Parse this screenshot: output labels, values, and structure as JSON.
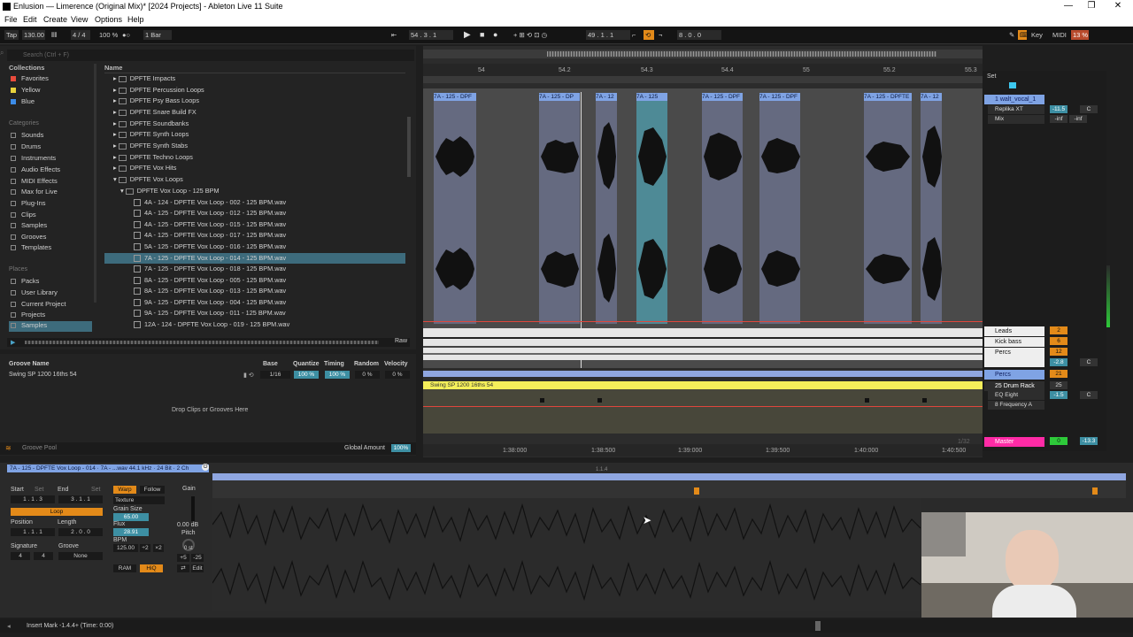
{
  "window": {
    "title": "Enlusion — Limerence (Original Mix)* [2024 Projects] - Ableton Live 11 Suite",
    "minimize": "—",
    "maximize": "❐",
    "close": "✕"
  },
  "menu": [
    "File",
    "Edit",
    "Create",
    "View",
    "Options",
    "Help"
  ],
  "transport": {
    "tap": "Tap",
    "tempo": "130.00",
    "signature": "4 / 4",
    "zoom": "100 %",
    "quantization": "1 Bar",
    "position": "54 . 3 . 1",
    "loop_start": "49 . 1 . 1",
    "loop_length": "8 . 0 . 0",
    "key": "Key",
    "midi": "MIDI",
    "cpu": "13 %"
  },
  "browser": {
    "search_placeholder": "Search (Ctrl + F)",
    "collections_header": "Collections",
    "name_header": "Name",
    "collections": [
      {
        "label": "Favorites",
        "color": "#e84b3c"
      },
      {
        "label": "Yellow",
        "color": "#e8d23c"
      },
      {
        "label": "Blue",
        "color": "#3c8ce8"
      }
    ],
    "categories_header": "Categories",
    "categories": [
      "Sounds",
      "Drums",
      "Instruments",
      "Audio Effects",
      "MIDI Effects",
      "Max for Live",
      "Plug-Ins",
      "Clips",
      "Samples",
      "Grooves",
      "Templates"
    ],
    "places_header": "Places",
    "places": [
      "Packs",
      "User Library",
      "Current Project",
      "Projects",
      "Samples"
    ],
    "folders": [
      "DPFTE Impacts",
      "DPFTE Percussion Loops",
      "DPFTE Psy Bass Loops",
      "DPFTE Snare Build FX",
      "DPFTE Soundbanks",
      "DPFTE Synth Loops",
      "DPFTE Synth Stabs",
      "DPFTE Techno Loops",
      "DPFTE Vox Hits",
      "DPFTE Vox Loops"
    ],
    "subfolder": "DPFTE Vox Loop - 125 BPM",
    "files": [
      "4A - 124 - DPFTE Vox Loop - 002 - 125 BPM.wav",
      "4A - 125 - DPFTE Vox Loop - 012 - 125 BPM.wav",
      "4A - 125 - DPFTE Vox Loop - 015 - 125 BPM.wav",
      "4A - 125 - DPFTE Vox Loop - 017 - 125 BPM.wav",
      "5A - 125 - DPFTE Vox Loop - 016 - 125 BPM.wav",
      "7A - 125 - DPFTE Vox Loop - 014 - 125 BPM.wav",
      "7A - 125 - DPFTE Vox Loop - 018 - 125 BPM.wav",
      "8A - 125 - DPFTE Vox Loop - 005 - 125 BPM.wav",
      "8A - 125 - DPFTE Vox Loop - 013 - 125 BPM.wav",
      "9A - 125 - DPFTE Vox Loop - 004 - 125 BPM.wav",
      "9A - 125 - DPFTE Vox Loop - 011 - 125 BPM.wav",
      "12A - 124 - DPFTE Vox Loop - 019 - 125 BPM.wav"
    ],
    "raw": "Raw"
  },
  "groove": {
    "headers": {
      "name": "Groove Name",
      "base": "Base",
      "quantize": "Quantize",
      "timing": "Timing",
      "random": "Random",
      "velocity": "Velocity"
    },
    "row": {
      "name": "Swing SP 1200 16ths 54",
      "base": "1/16",
      "quantize": "100 %",
      "timing": "100 %",
      "random": "0 %",
      "velocity": "0 %"
    },
    "drop_hint": "Drop Clips or Grooves Here",
    "pool_label": "Groove Pool",
    "global_amount_label": "Global Amount",
    "global_amount": "100%"
  },
  "arrangement": {
    "bars": [
      "54",
      "54.2",
      "54.3",
      "54.4",
      "55",
      "55.2",
      "55.3"
    ],
    "times": [
      "1:38:000",
      "1:38:500",
      "1:39:000",
      "1:39:500",
      "1:40:000",
      "1:40:500"
    ],
    "set_label": "Set",
    "clip_labels": [
      "7A - 125 - DPF",
      "7A - 125 - DP",
      "7A - 12",
      "7A - 125",
      "7A - 125 - DPF",
      "7A - 125 - DPF",
      "7A - 125 - DPFTE",
      "7A - 12"
    ],
    "groove_clip": "Swing SP 1200 16ths 54",
    "zoom_label": "1/32"
  },
  "mixer": {
    "tracks": [
      {
        "name": "1 walt_vocal_1",
        "color": "#7fa3e4",
        "devices": [
          "Replika XT",
          "Mix"
        ],
        "vol": "-11.5",
        "pan": "C",
        "send": "-inf"
      },
      {
        "name": "Leads",
        "color": "#f0f0f0",
        "num": "2"
      },
      {
        "name": "Kick bass",
        "color": "#f0f0f0",
        "num": "6"
      },
      {
        "name": "Percs",
        "color": "#f0f0f0",
        "num": "12",
        "vol": "-2.8",
        "pan": "C"
      },
      {
        "name": "Percs",
        "color": "#7fa3e4",
        "num": "21"
      },
      {
        "name": "25 Drum Rack",
        "color": "#f0f0f0",
        "num": "25",
        "devices": [
          "EQ Eight",
          "8 Frequency A"
        ],
        "vol": "-1.5",
        "pan": "C"
      },
      {
        "name": "Master",
        "color": "#ff2ba6",
        "num": "0",
        "vol": "-13.3"
      }
    ]
  },
  "detail": {
    "clip_name": "7A - 125 - DPFTE Vox Loop - 014",
    "clip_info": "7A - ...wav  44.1 kHz · 24 Bit · 2 Ch",
    "start_label": "Start",
    "end_label": "End",
    "set1": "Set",
    "set2": "Set",
    "start": "1 . 1 . 3",
    "end": "3 . 1 . 1",
    "loop": "Loop",
    "position_label": "Position",
    "length_label": "Length",
    "position": "1 . 1 . 1",
    "length": "2 . 0 . 0",
    "signature_label": "Signature",
    "groove_label": "Groove",
    "sig_num": "4",
    "sig_den": "4",
    "groove": "None",
    "warp": "Warp",
    "follow": "Follow",
    "mode": "Texture",
    "grain_size_label": "Grain Size",
    "grain_size": "65.00",
    "flux_label": "Flux",
    "flux": "28.91",
    "bpm_label": "BPM",
    "bpm": "125.00",
    "half": "÷2",
    "double": "×2",
    "ram": "RAM",
    "hiq": "HiQ",
    "gain_label": "Gain",
    "gain": "0.00 dB",
    "pitch_label": "Pitch",
    "pitch": "0 st",
    "transpose_up": "+5",
    "transpose_down": "-25",
    "edit": "Edit",
    "ruler": "1.1.4"
  },
  "status": {
    "text": "Insert Mark -1.4.4+ (Time: 0:00)"
  }
}
